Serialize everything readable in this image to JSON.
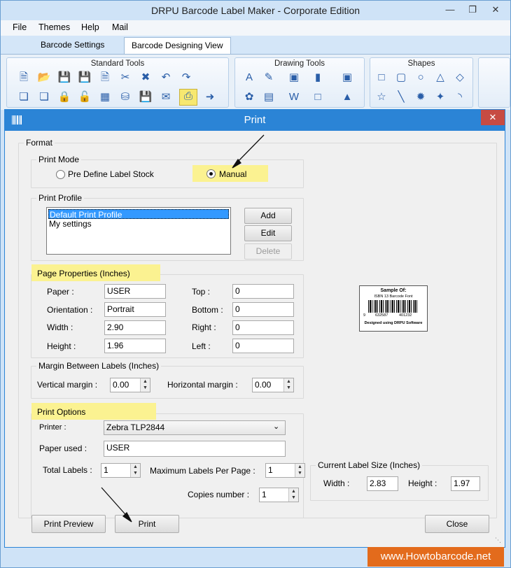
{
  "window": {
    "title": "DRPU Barcode Label Maker - Corporate Edition"
  },
  "menu": [
    "File",
    "Themes",
    "Help",
    "Mail"
  ],
  "tabs": [
    "Barcode Settings",
    "Barcode Designing View"
  ],
  "ribbon": {
    "groups": [
      "Standard Tools",
      "Drawing Tools",
      "Shapes"
    ]
  },
  "dialog": {
    "title": "Print",
    "close_glyph": "✕",
    "format": {
      "legend": "Format"
    },
    "print_mode": {
      "legend": "Print Mode",
      "option_predefine": "Pre Define Label Stock",
      "option_manual": "Manual",
      "selected": "Manual"
    },
    "print_profile": {
      "legend": "Print Profile",
      "items": [
        "Default Print Profile",
        "My settings"
      ],
      "add": "Add",
      "edit": "Edit",
      "delete": "Delete"
    },
    "page_properties": {
      "legend": "Page Properties (Inches)",
      "paper_label": "Paper :",
      "paper": "USER",
      "orientation_label": "Orientation :",
      "orientation": "Portrait",
      "width_label": "Width :",
      "width": "2.90",
      "height_label": "Height :",
      "height": "1.96",
      "top_label": "Top :",
      "top": "0",
      "bottom_label": "Bottom :",
      "bottom": "0",
      "right_label": "Right :",
      "right": "0",
      "left_label": "Left :",
      "left": "0"
    },
    "margin": {
      "legend": "Margin Between Labels (Inches)",
      "vertical_label": "Vertical margin :",
      "vertical": "0.00",
      "horizontal_label": "Horizontal margin :",
      "horizontal": "0.00"
    },
    "print_options": {
      "legend": "Print Options",
      "printer_label": "Printer :",
      "printer": "Zebra TLP2844",
      "paper_used_label": "Paper used :",
      "paper_used": "USER",
      "total_labels_label": "Total Labels :",
      "total_labels": "1",
      "max_labels_label": "Maximum Labels Per Page :",
      "max_labels": "1",
      "copies_label": "Copies number :",
      "copies": "1"
    },
    "current_size": {
      "legend": "Current Label Size (Inches)",
      "width_label": "Width :",
      "width": "2.83",
      "height_label": "Height :",
      "height": "1.97"
    },
    "preview": {
      "line1": "Sample Of:",
      "line2": "ISBN 13 Barcode Font",
      "digits_a": "9",
      "digits_b": "632587",
      "digits_c": "401232",
      "footer": "Designed using DRPU Software"
    },
    "buttons": {
      "print_preview": "Print Preview",
      "print": "Print",
      "close": "Close"
    }
  },
  "watermark": "www.Howtobarcode.net",
  "colors": {
    "dialog_title": "#2b84d6",
    "highlight": "#fbf291",
    "close_red": "#c74b42",
    "watermark": "#e36b1c"
  }
}
